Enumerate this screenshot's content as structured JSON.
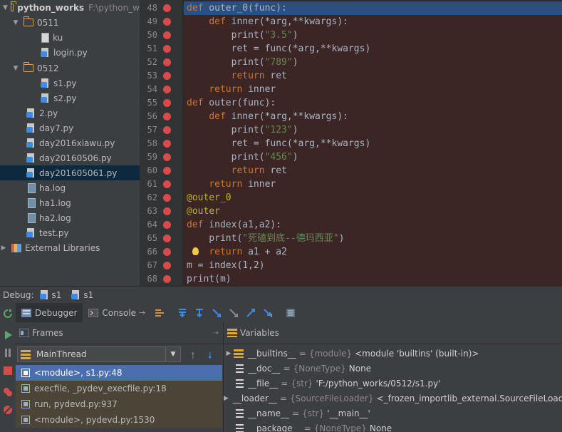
{
  "project_tree": {
    "rows": [
      {
        "label": "python_works",
        "hint": "F:\\python_w",
        "type": "folder",
        "expanded": true,
        "indent": 0
      },
      {
        "label": "0511",
        "type": "folder",
        "expanded": true,
        "indent": 1
      },
      {
        "label": "ku",
        "type": "file",
        "indent": 2
      },
      {
        "label": "login.py",
        "type": "py",
        "indent": 2
      },
      {
        "label": "0512",
        "type": "folder",
        "expanded": true,
        "indent": 1
      },
      {
        "label": "s1.py",
        "type": "py",
        "indent": 2
      },
      {
        "label": "s2.py",
        "type": "py",
        "indent": 2
      },
      {
        "label": "2.py",
        "type": "py",
        "indent": 1
      },
      {
        "label": "day7.py",
        "type": "py",
        "indent": 1
      },
      {
        "label": "day2016xiawu.py",
        "type": "py",
        "indent": 1
      },
      {
        "label": "day20160506.py",
        "type": "py",
        "indent": 1
      },
      {
        "label": "day201605061.py",
        "type": "py",
        "indent": 1,
        "selected": true
      },
      {
        "label": "ha.log",
        "type": "log",
        "indent": 1
      },
      {
        "label": "ha1.log",
        "type": "log",
        "indent": 1
      },
      {
        "label": "ha2.log",
        "type": "log",
        "indent": 1
      },
      {
        "label": "test.py",
        "type": "py",
        "indent": 1
      },
      {
        "label": "External Libraries",
        "type": "lib",
        "expanded": false,
        "indent": 0
      }
    ]
  },
  "editor": {
    "lines": [
      {
        "n": "48",
        "text": "def outer_0(func):",
        "current": true
      },
      {
        "n": "49",
        "text": "    def inner(*arg,**kwargs):"
      },
      {
        "n": "50",
        "text": "        print(\"3.5\")"
      },
      {
        "n": "51",
        "text": "        ret = func(*arg,**kwargs)"
      },
      {
        "n": "52",
        "text": "        print(\"789\")"
      },
      {
        "n": "53",
        "text": "        return ret"
      },
      {
        "n": "54",
        "text": "    return inner"
      },
      {
        "n": "55",
        "text": "def outer(func):"
      },
      {
        "n": "56",
        "text": "    def inner(*arg,**kwargs):"
      },
      {
        "n": "57",
        "text": "        print(\"123\")"
      },
      {
        "n": "58",
        "text": "        ret = func(*arg,**kwargs)"
      },
      {
        "n": "59",
        "text": "        print(\"456\")"
      },
      {
        "n": "60",
        "text": "        return ret"
      },
      {
        "n": "61",
        "text": "    return inner"
      },
      {
        "n": "62",
        "text": "@outer_0"
      },
      {
        "n": "63",
        "text": "@outer"
      },
      {
        "n": "64",
        "text": "def index(a1,a2):"
      },
      {
        "n": "65",
        "text": "    print(\"死磕到底--德玛西亚\")"
      },
      {
        "n": "66",
        "text": "    return a1 + a2",
        "bulb": true
      },
      {
        "n": "67",
        "text": "m = index(1,2)"
      },
      {
        "n": "68",
        "text": "print(m)"
      }
    ]
  },
  "debug": {
    "label": "Debug:",
    "run_tabs": [
      "s1",
      "s1"
    ],
    "tabs": {
      "debugger": "Debugger",
      "console": "Console"
    },
    "frames_title": "Frames",
    "thread": "MainThread",
    "frames": [
      {
        "label": "<module>, s1.py:48",
        "selected": true
      },
      {
        "label": "execfile, _pydev_execfile.py:18"
      },
      {
        "label": "run, pydevd.py:937"
      },
      {
        "label": "<module>, pydevd.py:1530"
      }
    ],
    "variables_title": "Variables",
    "variables": [
      {
        "name": "__builtins__",
        "type": "{module}",
        "value": "<module 'builtins' (built-in)>",
        "expandable": true,
        "kind": "obj"
      },
      {
        "name": "__doc__",
        "type": "{NoneType}",
        "value": "None",
        "expandable": false,
        "kind": "field"
      },
      {
        "name": "__file__",
        "type": "{str}",
        "value": "'F:/python_works/0512/s1.py'",
        "expandable": false,
        "kind": "field"
      },
      {
        "name": "__loader__",
        "type": "{SourceFileLoader}",
        "value": "<_frozen_importlib_external.SourceFileLoad",
        "expandable": true,
        "kind": "obj"
      },
      {
        "name": "__name__",
        "type": "{str}",
        "value": "'__main__'",
        "expandable": false,
        "kind": "field"
      },
      {
        "name": "__package__",
        "type": "{NoneType}",
        "value": "None",
        "expandable": false,
        "kind": "field"
      }
    ]
  },
  "colors": {
    "breakpoint": "#d84b4b",
    "current_line": "#2d4f7e",
    "selected_frame": "#4b6eaf"
  }
}
